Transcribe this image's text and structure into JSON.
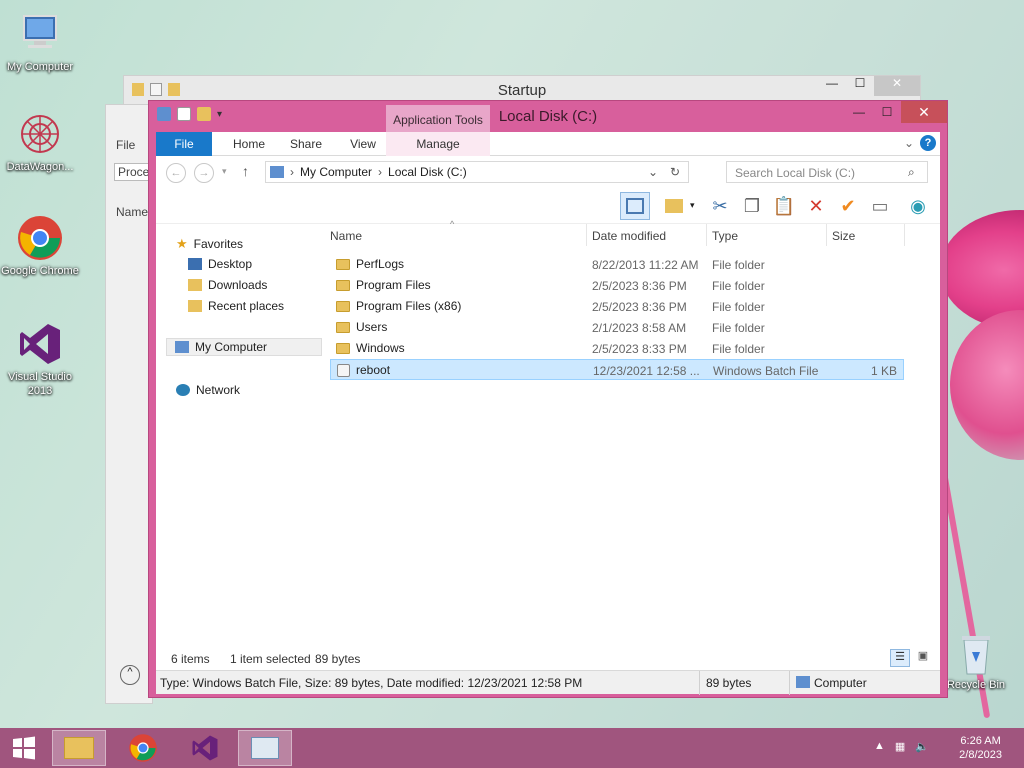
{
  "desktop": {
    "icons": [
      {
        "label": "My Computer",
        "icon": "computer-icon"
      },
      {
        "label": "DataWagon...",
        "icon": "datawagon-icon"
      },
      {
        "label": "Google Chrome",
        "icon": "chrome-icon"
      },
      {
        "label": "Visual Studio 2013",
        "icon": "visual-studio-icon"
      },
      {
        "label": "Recycle Bin",
        "icon": "recycle-bin-icon"
      }
    ]
  },
  "back_window": {
    "title": "Startup",
    "file_tab": "File",
    "proc_label": "Proce",
    "name_label": "Name"
  },
  "main_window": {
    "title": "Local Disk (C:)",
    "context_tab_group": "Application Tools",
    "tabs": [
      "File",
      "Home",
      "Share",
      "View",
      "Manage"
    ],
    "address": {
      "parts": [
        "My Computer",
        "Local Disk (C:)"
      ]
    },
    "search": {
      "placeholder": "Search Local Disk (C:)"
    },
    "nav": {
      "favorites": "Favorites",
      "desktop": "Desktop",
      "downloads": "Downloads",
      "recent": "Recent places",
      "my_computer": "My Computer",
      "network": "Network"
    },
    "columns": {
      "name": "Name",
      "date": "Date modified",
      "type": "Type",
      "size": "Size"
    },
    "files": [
      {
        "name": "PerfLogs",
        "date": "8/22/2013 11:22 AM",
        "type": "File folder",
        "size": ""
      },
      {
        "name": "Program Files",
        "date": "2/5/2023 8:36 PM",
        "type": "File folder",
        "size": ""
      },
      {
        "name": "Program Files (x86)",
        "date": "2/5/2023 8:36 PM",
        "type": "File folder",
        "size": ""
      },
      {
        "name": "Users",
        "date": "2/1/2023 8:58 AM",
        "type": "File folder",
        "size": ""
      },
      {
        "name": "Windows",
        "date": "2/5/2023 8:33 PM",
        "type": "File folder",
        "size": ""
      },
      {
        "name": "reboot",
        "date": "12/23/2021 12:58 ...",
        "type": "Windows Batch File",
        "size": "1 KB"
      }
    ],
    "status": {
      "items": "6 items",
      "selected": "1 item selected",
      "selected_size": "89 bytes"
    },
    "details": {
      "text": "Type: Windows Batch File, Size: 89 bytes, Date modified: 12/23/2021 12:58 PM",
      "size": "89 bytes",
      "location": "Computer"
    }
  },
  "taskbar": {
    "time": "6:26 AM",
    "date": "2/8/2023"
  }
}
